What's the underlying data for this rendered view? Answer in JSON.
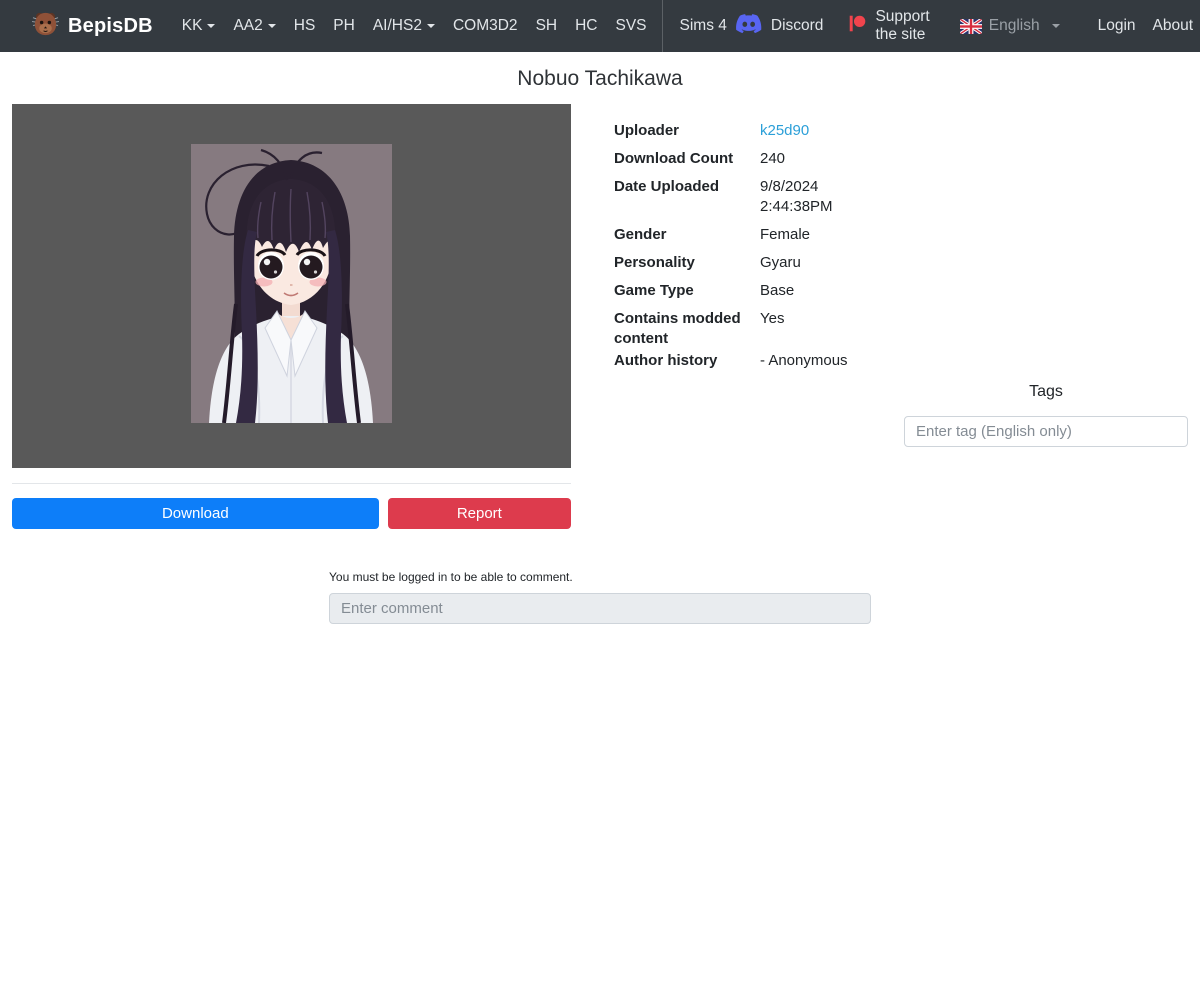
{
  "navbar": {
    "brand": "BepisDB",
    "items": [
      {
        "label": "KK",
        "caret": true
      },
      {
        "label": "AA2",
        "caret": true
      },
      {
        "label": "HS",
        "caret": false
      },
      {
        "label": "PH",
        "caret": false
      },
      {
        "label": "AI/HS2",
        "caret": true
      },
      {
        "label": "COM3D2",
        "caret": false
      },
      {
        "label": "SH",
        "caret": false
      },
      {
        "label": "HC",
        "caret": false
      },
      {
        "label": "SVS",
        "caret": false
      },
      {
        "label": "Sims 4",
        "caret": false,
        "divider_before": true
      }
    ],
    "discord_label": "Discord",
    "support_label": "Support the site",
    "language": "English",
    "login_label": "Login",
    "about_label": "About"
  },
  "page": {
    "title": "Nobuo Tachikawa"
  },
  "details": {
    "rows": [
      {
        "label": "Uploader",
        "value": "k25d90"
      },
      {
        "label": "Download Count",
        "value": "240"
      },
      {
        "label": "Date Uploaded",
        "value": "9/8/2024",
        "value2": "2:44:38PM"
      },
      {
        "label": "Gender",
        "value": "Female"
      },
      {
        "label": "Personality",
        "value": "Gyaru"
      },
      {
        "label": "Game Type",
        "value": "Base"
      },
      {
        "label": "Contains modded content",
        "value": "Yes"
      },
      {
        "label": "Author history",
        "value": "- Anonymous"
      }
    ]
  },
  "tags": {
    "heading": "Tags",
    "placeholder": "Enter tag (English only)"
  },
  "actions": {
    "download_label": "Download",
    "report_label": "Report"
  },
  "comments": {
    "notice": "You must be logged in to be able to comment.",
    "placeholder": "Enter comment"
  },
  "icons": {
    "logo": "bear-logo-icon",
    "discord": "discord-icon",
    "patreon": "patreon-icon",
    "language_flag": "uk-flag-icon",
    "dropdown": "caret-down-icon"
  },
  "colors": {
    "navbar_bg": "#343a40",
    "primary_button": "#0d7ef9",
    "danger_button": "#dd3b4d",
    "link": "#2b9fd8",
    "image_card_bg": "#595959",
    "portrait_bg": "#867a80",
    "discord_brand": "#5865f2",
    "patreon_brand": "#f0444d"
  }
}
